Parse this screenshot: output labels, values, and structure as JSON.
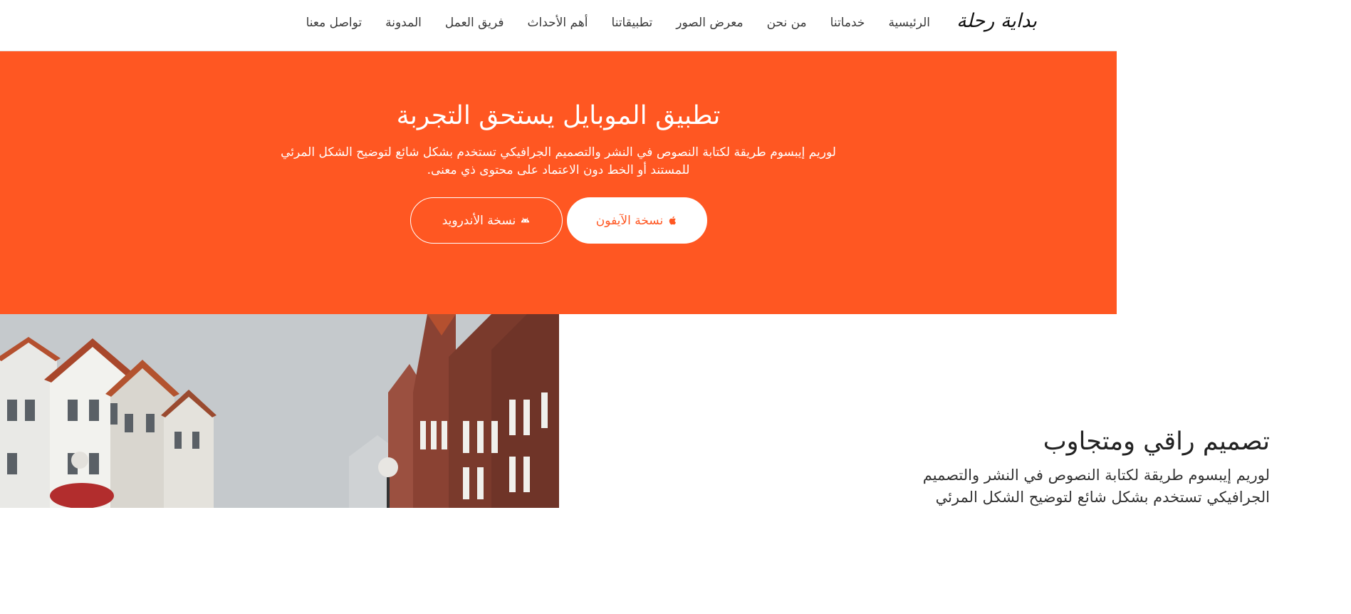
{
  "brand": {
    "logo_text": "بداية رحلة"
  },
  "nav": {
    "items": [
      "الرئيسية",
      "خدماتنا",
      "من نحن",
      "معرض الصور",
      "تطبيقاتنا",
      "أهم الأحداث",
      "فريق العمل",
      "المدونة",
      "تواصل معنا"
    ]
  },
  "hero": {
    "title": "تطبيق الموبايل يستحق التجربة",
    "text": "لوريم إيبسوم طريقة لكتابة النصوص في النشر والتصميم الجرافيكي تستخدم بشكل شائع لتوضيح الشكل المرئي للمستند أو الخط دون الاعتماد على محتوى ذي معنى.",
    "iphone_button": {
      "label": "نسخة الآيفون",
      "icon": "apple-icon"
    },
    "android_button": {
      "label": "نسخة الأندرويد",
      "icon": "android-icon"
    },
    "background_color": "#ff5722"
  },
  "feature": {
    "heading": "تصميم راقي ومتجاوب",
    "text": "لوريم إيبسوم طريقة لكتابة النصوص في النشر والتصميم الجرافيكي تستخدم بشكل شائع لتوضيح الشكل المرئي"
  },
  "colors": {
    "accent": "#ff5722",
    "text": "#222222",
    "nav_text": "#3a3a3a"
  }
}
